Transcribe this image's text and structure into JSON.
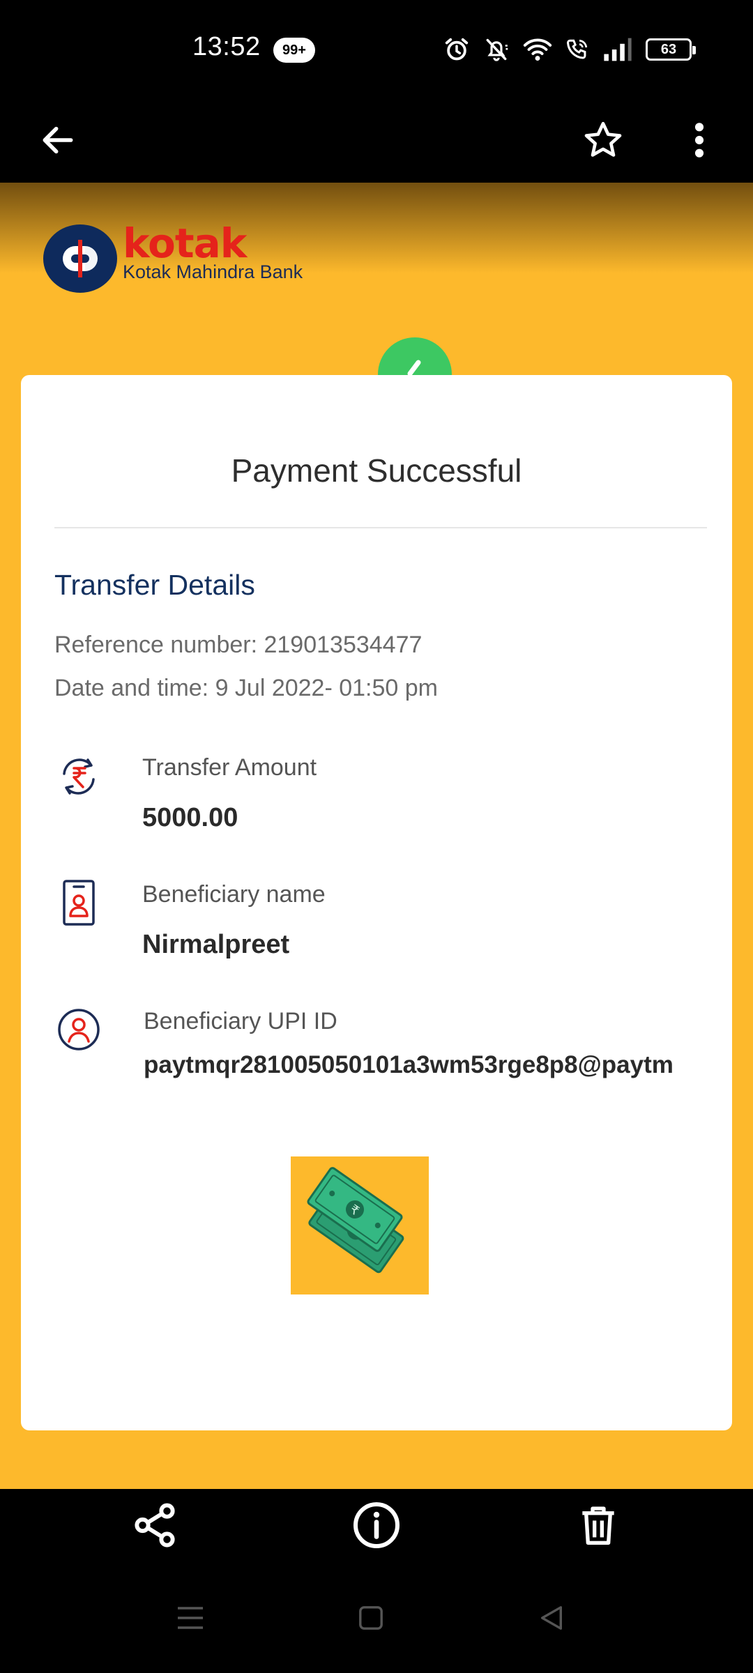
{
  "status_bar": {
    "time": "13:52",
    "notification_count": "99+",
    "battery_level": "63",
    "icons": [
      "alarm-icon",
      "muted-bell-icon",
      "wifi-icon",
      "wifi-calling-icon",
      "signal-icon",
      "battery-icon"
    ]
  },
  "app_bar": {
    "icons": [
      "back-arrow-icon",
      "star-icon",
      "more-vert-icon"
    ]
  },
  "receipt": {
    "bank_brand": "kotak",
    "bank_name": "Kotak Mahindra Bank",
    "title": "Payment Successful",
    "section_title": "Transfer Details",
    "reference": "Reference number: 219013534477",
    "date_time": "Date and time: 9 Jul 2022- 01:50 pm",
    "details": [
      {
        "label": "Transfer Amount",
        "value": "5000.00",
        "icon": "rupee-transfer-icon"
      },
      {
        "label": "Beneficiary name",
        "value": "Nirmalpreet",
        "icon": "id-card-icon"
      },
      {
        "label": "Beneficiary UPI ID",
        "value": "paytmqr281005050101a3wm53rge8p8@paytm",
        "icon": "user-circle-icon"
      }
    ],
    "colors": {
      "background": "#FDB92C",
      "brand_red": "#E5231B",
      "brand_navy": "#0E2A5C",
      "success_green": "#3DC862",
      "section_title": "#14315F"
    }
  },
  "action_bar": {
    "icons": [
      "share-icon",
      "info-icon",
      "delete-icon"
    ]
  },
  "nav_bar": {
    "icons": [
      "menu-icon",
      "home-square-icon",
      "back-triangle-icon"
    ]
  }
}
